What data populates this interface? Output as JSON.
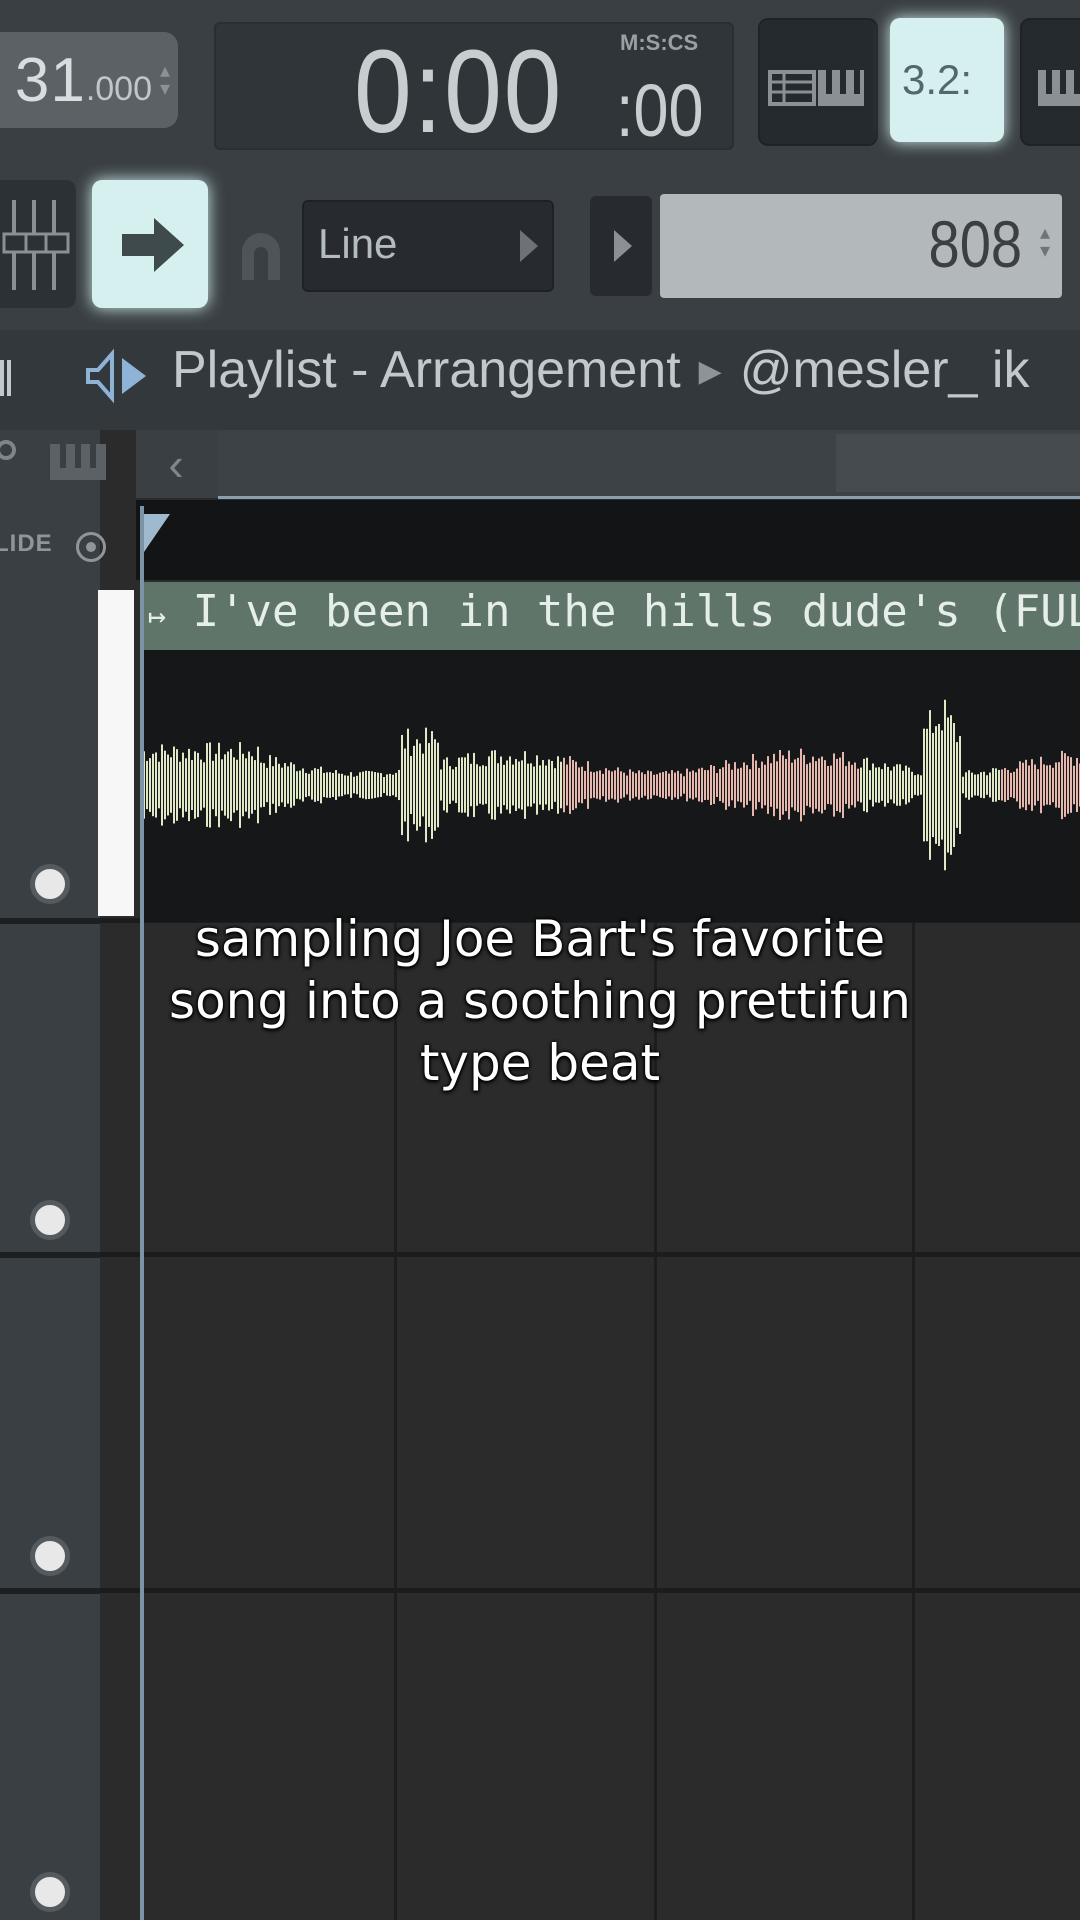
{
  "toolbar": {
    "tempo": "31",
    "tempo_fraction": ".000",
    "time": "0:00",
    "time_cs": ":00",
    "time_format": "M:S:CS",
    "snap_mode": "Line",
    "pattern": "808",
    "beat_button": "3.2:"
  },
  "playlist": {
    "title": "Playlist - Arrangement",
    "owner": "@mesler_ ik",
    "glide_label": "LIDE"
  },
  "clip": {
    "title": "I've been in the hills dude's (FULL SONG"
  },
  "caption": {
    "line1": "sampling Joe Bart's favorite",
    "line2": "song into a soothing prettifun",
    "line3": "type beat"
  },
  "colors": {
    "clip_header": "#5f756a",
    "waveform_green": "#dfe9c7",
    "waveform_pink": "#e6b7ac",
    "playhead": "#7c93a8"
  }
}
